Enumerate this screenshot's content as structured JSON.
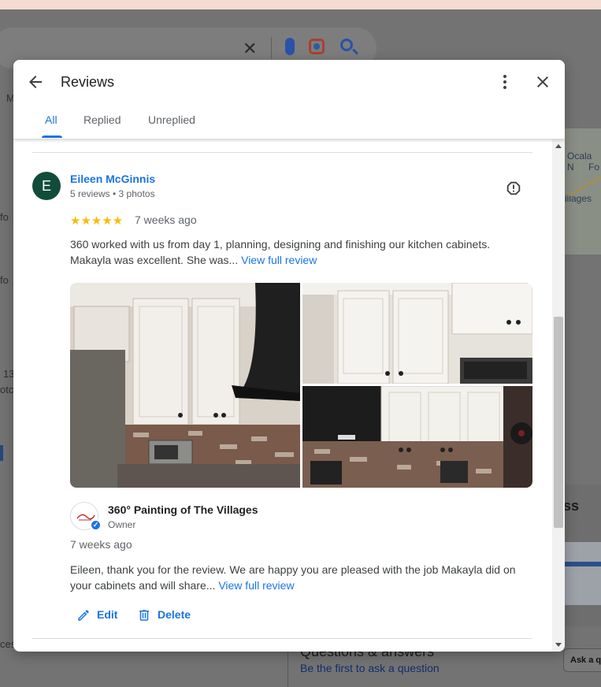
{
  "background": {
    "left_texts": [
      "M",
      "fo",
      "fo",
      "13",
      "otc",
      "ces"
    ],
    "map_labels": [
      "Ocala N",
      "Fo",
      "illages"
    ],
    "section_heading": "ss",
    "qa_heading": "Questions & answers",
    "ask_link": "Be the first to ask a question",
    "ask_button": "Ask a q"
  },
  "dialog": {
    "title": "Reviews",
    "tabs": [
      {
        "label": "All",
        "active": true
      },
      {
        "label": "Replied",
        "active": false
      },
      {
        "label": "Unreplied",
        "active": false
      }
    ]
  },
  "review": {
    "avatar_letter": "E",
    "avatar_color": "#114c3a",
    "author": "Eileen McGinnis",
    "author_meta": "5 reviews • 3 photos",
    "rating": 5,
    "stars": "★★★★★",
    "time": "7 weeks ago",
    "text": "360 worked with us from day 1, planning, designing and finishing our kitchen cabinets. Makayla was excellent. She was...",
    "more_link": "View full review",
    "photos": [
      "kitchen-hood-photo",
      "upper-cabinets-photo",
      "range-hood-cabinets-photo"
    ]
  },
  "reply": {
    "business_name": "360° Painting of The Villages",
    "role": "Owner",
    "time": "7 weeks ago",
    "text": "Eileen, thank you for the review. We are happy you are pleased with the job Makayla did on your cabinets and will share...",
    "more_link": "View full review",
    "edit_label": "Edit",
    "delete_label": "Delete"
  },
  "colors": {
    "accent": "#1a73e8",
    "stars": "#fbbc04"
  }
}
